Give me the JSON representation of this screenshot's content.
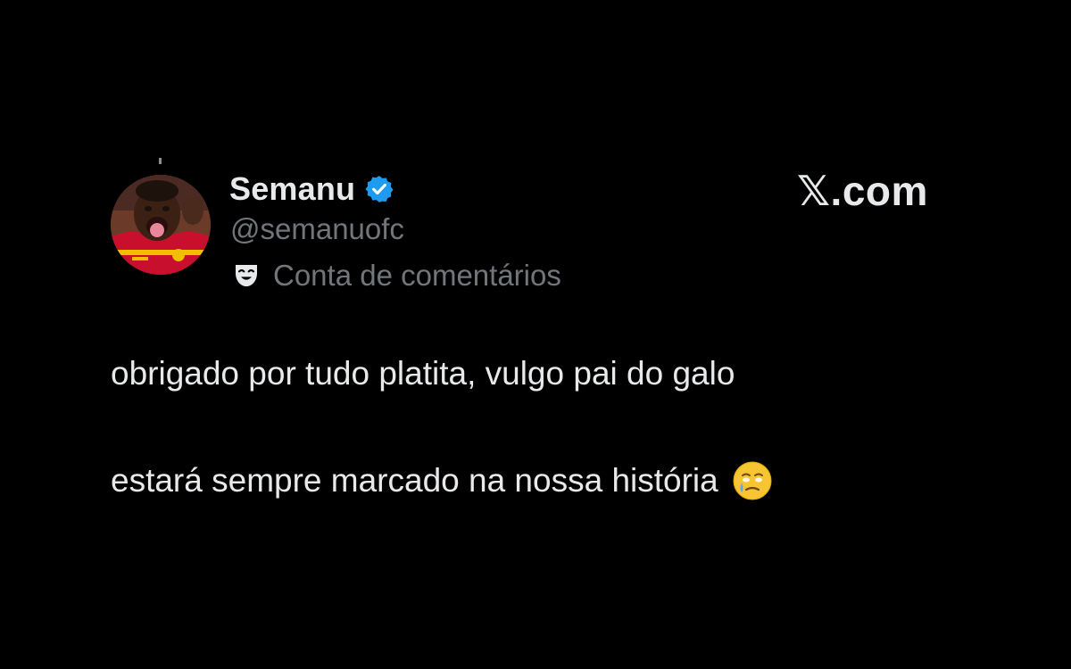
{
  "post": {
    "author": {
      "display_name": "Semanu",
      "handle": "@semanuofc",
      "verified": true,
      "account_label": "Conta de comentários",
      "label_icon": "theater-masks-icon",
      "avatar_icon": "profile-avatar"
    },
    "text_lines": [
      "obrigado por tudo platita, vulgo pai do galo",
      "estará sempre marcado na nossa história"
    ],
    "emoji": "face-holding-back-tears-icon"
  },
  "watermark": {
    "text": "𝕏.com"
  },
  "colors": {
    "background": "#000000",
    "primary_text": "#e7e9ea",
    "secondary_text": "#71767b",
    "verified_blue": "#1d9bf0"
  }
}
